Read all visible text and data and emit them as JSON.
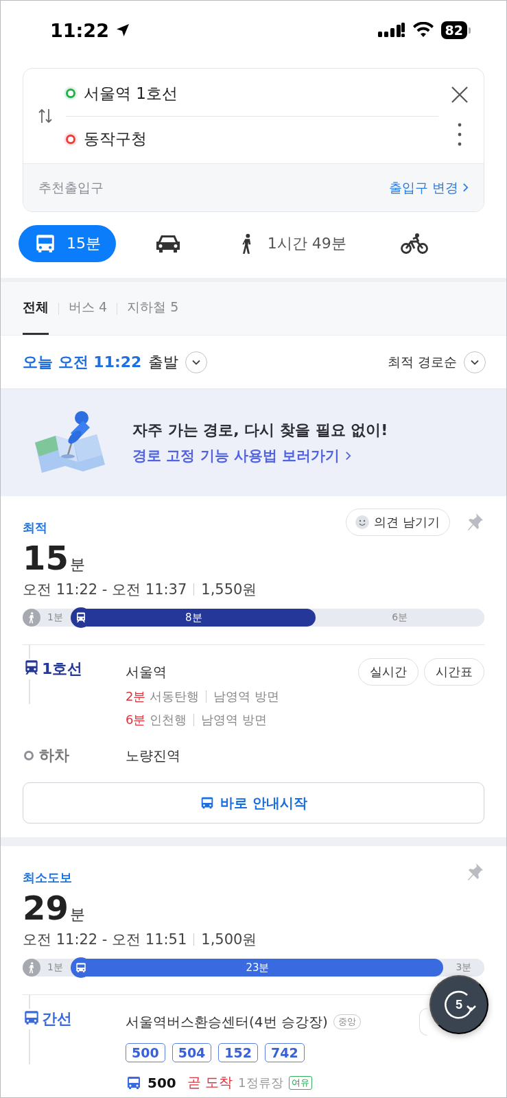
{
  "status_bar": {
    "time": "11:22",
    "battery": "82"
  },
  "search": {
    "origin": "서울역 1호선",
    "destination": "동작구청",
    "footer_label": "추천출입구",
    "footer_link": "출입구 변경"
  },
  "modes": [
    {
      "kind": "transit",
      "label": "15분",
      "selected": true
    },
    {
      "kind": "car",
      "selected": false
    },
    {
      "kind": "walk",
      "label": "1시간 49분",
      "selected": false
    },
    {
      "kind": "bike",
      "selected": false
    }
  ],
  "tabs": [
    {
      "label": "전체",
      "selected": true
    },
    {
      "label": "버스 4",
      "selected": false
    },
    {
      "label": "지하철 5",
      "selected": false
    }
  ],
  "departure": {
    "time": "오늘 오전 11:22",
    "suffix": "출발",
    "sort": "최적 경로순"
  },
  "banner": {
    "title": "자주 가는 경로, 다시 찾을 필요 없이!",
    "link": "경로 고정 기능 사용법 보러가기"
  },
  "routes": [
    {
      "label": "최적",
      "feedback": "의견 남기기",
      "duration": "15",
      "unit": "분",
      "times": "오전 11:22 - 오전 11:37",
      "fare": "1,550원",
      "bar": {
        "walk": "1분",
        "ride": "8분",
        "rest": "6분",
        "level": 0.59,
        "kind": "subway",
        "color": "#25389a"
      },
      "leg": {
        "kind": "subway",
        "line": "1호선",
        "color": "#25389a",
        "stop": "서울역",
        "buttons": [
          "실시간",
          "시간표"
        ],
        "arrivals": [
          {
            "wait": "2분",
            "dest": "서동탄행",
            "dir": "남영역 방면"
          },
          {
            "wait": "6분",
            "dest": "인천행",
            "dir": "남영역 방면"
          }
        ],
        "alight_label": "하차",
        "alight_stop": "노량진역"
      },
      "start_button": "바로 안내시작"
    },
    {
      "label": "최소도보",
      "duration": "29",
      "unit": "분",
      "times": "오전 11:22 - 오전 11:51",
      "fare": "1,500원",
      "bar": {
        "walk": "1분",
        "ride": "23분",
        "rest": "3분",
        "level": 0.9,
        "kind": "bus",
        "color": "#3a6ae0"
      },
      "leg": {
        "kind": "bus",
        "line": "간선",
        "color": "#3a6ae0",
        "stop": "서울역버스환승센터(4번 승강장)",
        "stop_tag": "중앙",
        "bus_numbers": [
          "500",
          "504",
          "152",
          "742"
        ],
        "bus_arrival": {
          "number": "500",
          "status": "곧 도착",
          "stops": "1정류장",
          "crowding": "여유"
        }
      }
    }
  ],
  "fab": {
    "count": "5"
  }
}
